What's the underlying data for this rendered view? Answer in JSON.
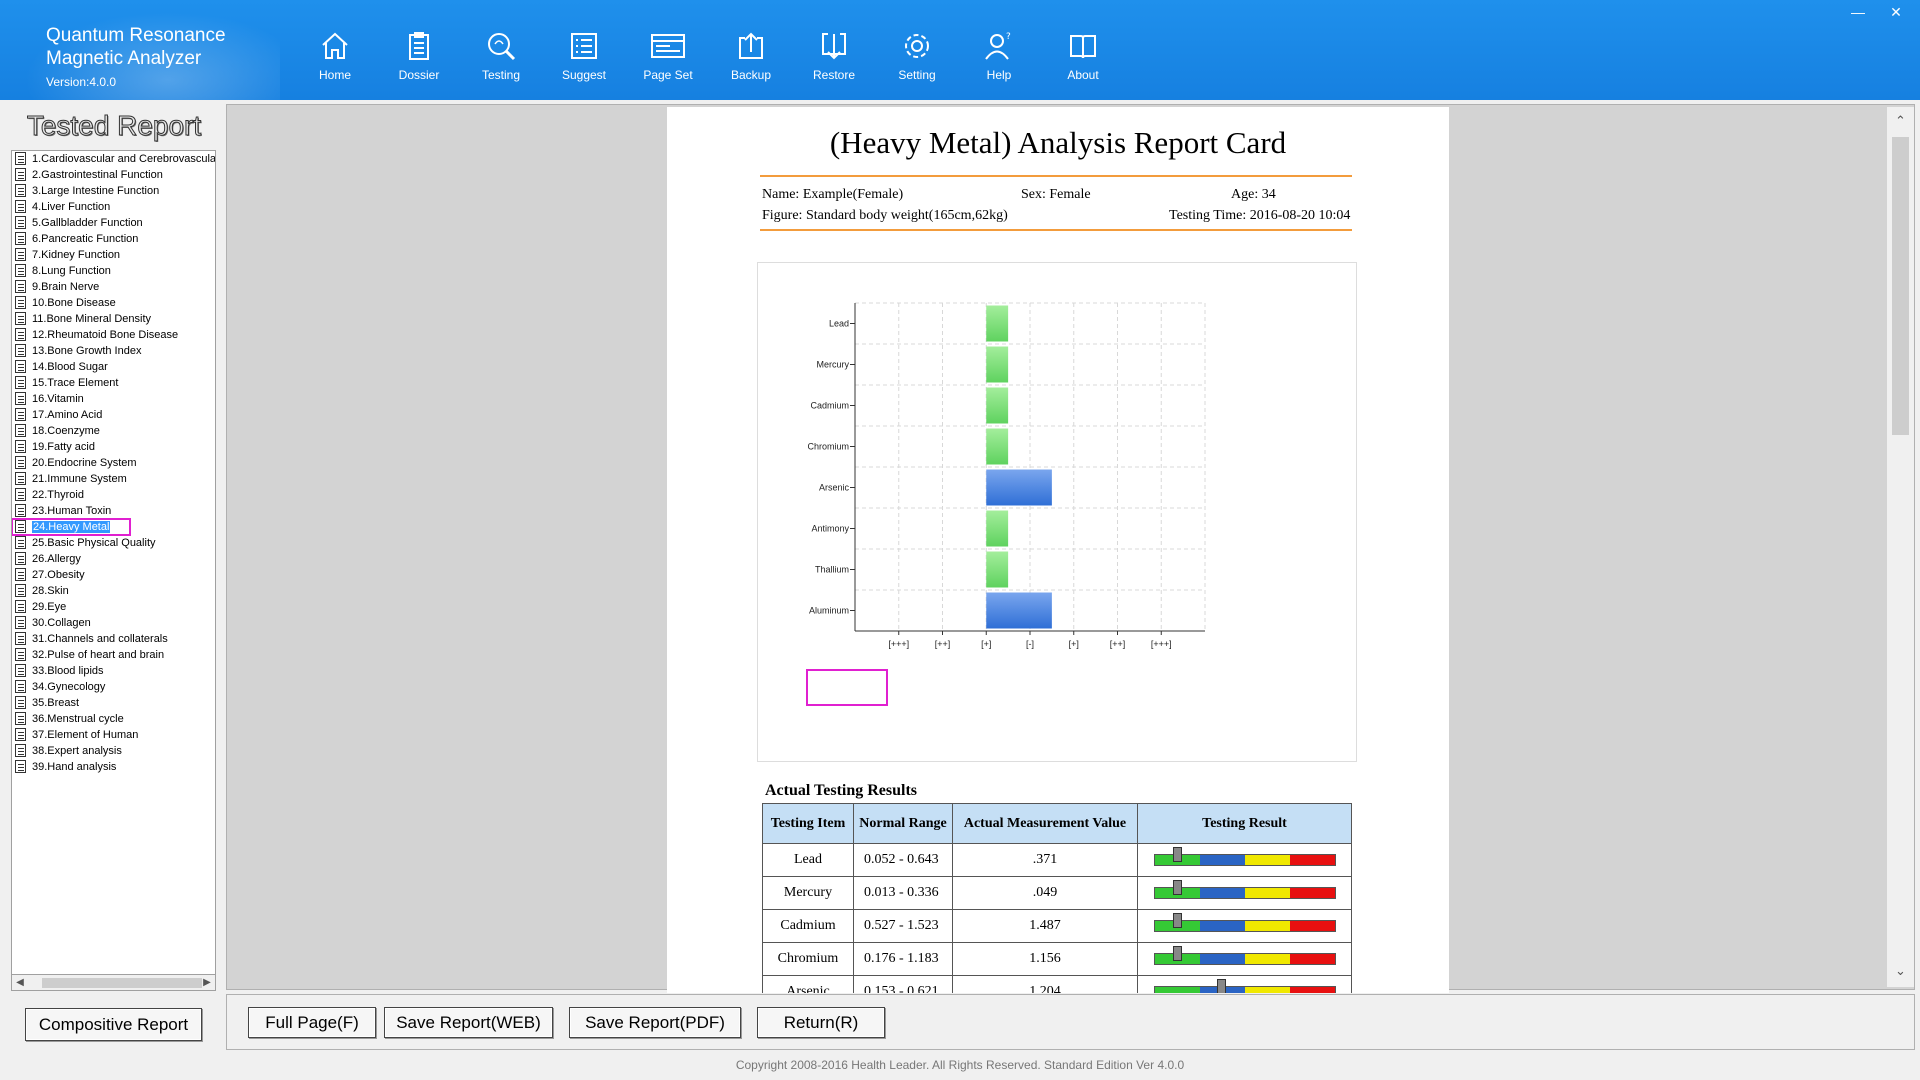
{
  "app": {
    "title_line1": "Quantum Resonance",
    "title_line2": "Magnetic Analyzer",
    "version": "Version:4.0.0"
  },
  "toolbar": [
    {
      "label": "Home",
      "icon": "home-icon"
    },
    {
      "label": "Dossier",
      "icon": "dossier-icon"
    },
    {
      "label": "Testing",
      "icon": "testing-icon"
    },
    {
      "label": "Suggest",
      "icon": "suggest-icon"
    },
    {
      "label": "Page Set",
      "icon": "page-set-icon"
    },
    {
      "label": "Backup",
      "icon": "backup-icon"
    },
    {
      "label": "Restore",
      "icon": "restore-icon"
    },
    {
      "label": "Setting",
      "icon": "setting-icon"
    },
    {
      "label": "Help",
      "icon": "help-icon"
    },
    {
      "label": "About",
      "icon": "about-icon"
    }
  ],
  "window_controls": {
    "minimize": "—",
    "close": "✕"
  },
  "left_panel": {
    "title": "Tested Report",
    "items": [
      "1.Cardiovascular and Cerebrovascular",
      "2.Gastrointestinal Function",
      "3.Large Intestine Function",
      "4.Liver Function",
      "5.Gallbladder Function",
      "6.Pancreatic Function",
      "7.Kidney Function",
      "8.Lung Function",
      "9.Brain Nerve",
      "10.Bone Disease",
      "11.Bone Mineral Density",
      "12.Rheumatoid Bone Disease",
      "13.Bone Growth Index",
      "14.Blood Sugar",
      "15.Trace Element",
      "16.Vitamin",
      "17.Amino Acid",
      "18.Coenzyme",
      "19.Fatty acid",
      "20.Endocrine System",
      "21.Immune System",
      "22.Thyroid",
      "23.Human Toxin",
      "24.Heavy Metal",
      "25.Basic Physical Quality",
      "26.Allergy",
      "27.Obesity",
      "28.Skin",
      "29.Eye",
      "30.Collagen",
      "31.Channels and collaterals",
      "32.Pulse of heart and brain",
      "33.Blood lipids",
      "34.Gynecology",
      "35.Breast",
      "36.Menstrual cycle",
      "37.Element of Human",
      "38.Expert analysis",
      "39.Hand analysis"
    ],
    "selected_index": 23,
    "composite_button": "Compositive Report"
  },
  "report": {
    "title": "(Heavy Metal) Analysis Report Card",
    "name": "Name: Example(Female)",
    "sex": "Sex: Female",
    "age": "Age: 34",
    "figure": "Figure: Standard body weight(165cm,62kg)",
    "testing_time": "Testing Time: 2016-08-20 10:04",
    "results_title": "Actual Testing Results",
    "table_headers": [
      "Testing Item",
      "Normal Range",
      "Actual Measurement Value",
      "Testing Result"
    ],
    "rows": [
      {
        "item": "Lead",
        "range": "0.052 - 0.643",
        "value": ".371",
        "gauge_level": 0.13
      },
      {
        "item": "Mercury",
        "range": "0.013 - 0.336",
        "value": ".049",
        "gauge_level": 0.13
      },
      {
        "item": "Cadmium",
        "range": "0.527 - 1.523",
        "value": "1.487",
        "gauge_level": 0.13
      },
      {
        "item": "Chromium",
        "range": "0.176 - 1.183",
        "value": "1.156",
        "gauge_level": 0.13
      },
      {
        "item": "Arsenic",
        "range": "0.153 - 0.621",
        "value": "1.204",
        "gauge_level": 0.37
      }
    ]
  },
  "chart_data": {
    "type": "bar",
    "orientation": "horizontal",
    "categories": [
      "Lead",
      "Mercury",
      "Cadmium",
      "Chromium",
      "Arsenic",
      "Antimony",
      "Thallium",
      "Aluminum"
    ],
    "x_tick_labels": [
      "[+++]",
      "[++]",
      "[+]",
      "[-]",
      "[+]",
      "[++]",
      "[+++]"
    ],
    "values": [
      0.5,
      0.5,
      0.5,
      0.5,
      1.5,
      0.5,
      0.5,
      1.5
    ],
    "bar_colors": [
      "#5fd25f",
      "#5fd25f",
      "#5fd25f",
      "#5fd25f",
      "#2f6fd6",
      "#5fd25f",
      "#5fd25f",
      "#2f6fd6"
    ],
    "xlim": [
      -3,
      4
    ],
    "grid": true,
    "highlighted_category": "Aluminum"
  },
  "buttons": {
    "full_page": "Full Page(F)",
    "save_web": "Save Report(WEB)",
    "save_pdf": "Save Report(PDF)",
    "return": "Return(R)"
  },
  "footer": "Copyright 2008-2016 Health Leader. All Rights Reserved.  Standard Edition Ver 4.0.0"
}
